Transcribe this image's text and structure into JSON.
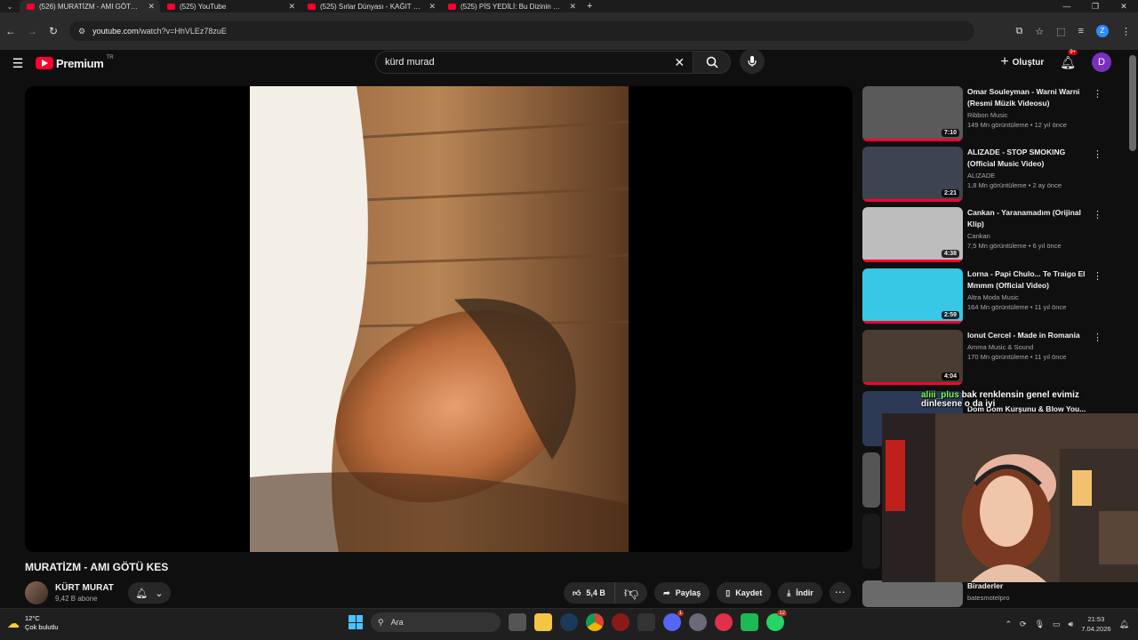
{
  "browser": {
    "tabs": [
      {
        "title": "(526) MURATİZM - AMI GÖTÜ KES",
        "active": true
      },
      {
        "title": "(525) YouTube",
        "active": false
      },
      {
        "title": "(525) Sırlar Dünyası - KAĞIT PARA",
        "active": false
      },
      {
        "title": "(525) PİS YEDİLİ: Bu Dizinin SONU",
        "active": false
      }
    ],
    "url_host": "youtube.com",
    "url_path": "/watch?v=HhVLEz78zuE",
    "profile_letter": "Z"
  },
  "youtube": {
    "logo_text": "Premium",
    "region": "TR",
    "search_query": "kürd murad",
    "create_label": "Oluştur",
    "notif_badge": "9+",
    "avatar_letter": "D"
  },
  "video": {
    "title": "MURATİZM - AMI GÖTÜ KES",
    "channel": "KÜRT MURAT",
    "subscribers": "9,42 B abone",
    "likes": "5,4 B",
    "share_label": "Paylaş",
    "save_label": "Kaydet",
    "download_label": "İndir"
  },
  "related": [
    {
      "title": "Omar Souleyman - Warni Warni (Resmi Müzik Videosu)",
      "channel": "Ribbon Music",
      "meta": "149 Mn görüntüleme • 12 yıl önce",
      "duration": "7:10",
      "thumb": "#5a5a5a"
    },
    {
      "title": "ALIZADE - STOP SMOKING (Official Music Video)",
      "channel": "ALIZADE",
      "meta": "1,8 Mn görüntüleme • 2 ay önce",
      "duration": "2:21",
      "thumb": "#3d4450"
    },
    {
      "title": "Cankan - Yaranamadım (Orijinal Klip)",
      "channel": "Cankan",
      "meta": "7,5 Mn görüntüleme • 6 yıl önce",
      "duration": "4:38",
      "thumb": "#bdbdbd"
    },
    {
      "title": "Lorna - Papi Chulo... Te Traigo El Mmmm (Official Video)",
      "channel": "Altra Moda Music",
      "meta": "164 Mn görüntüleme • 11 yıl önce",
      "duration": "2:59",
      "thumb": "#37c8e6"
    },
    {
      "title": "Ionut Cercel - Made in Romania",
      "channel": "Amma Music & Sound",
      "meta": "170 Mn görüntüleme • 11 yıl önce",
      "duration": "4:04",
      "thumb": "#4a3c30"
    },
    {
      "title": "Dom Dom Kurşunu & Blow You...",
      "channel": "",
      "meta": "",
      "duration": "",
      "thumb": "#2c3a55"
    },
    {
      "title": "Biraderler",
      "channel": "batesmotelpro",
      "meta": "",
      "duration": "",
      "thumb": "#6a6a6a"
    }
  ],
  "chat": {
    "user": "aliii_plus",
    "message": "bak renklensin genel evimiz dinlesene o da iyi"
  },
  "taskbar": {
    "temperature": "12°C",
    "weather": "Çok bulutlu",
    "search_placeholder": "Ara",
    "time": "21:53",
    "date": "7.04.2026",
    "discord_badge": "1",
    "whatsapp_badge": "12"
  }
}
